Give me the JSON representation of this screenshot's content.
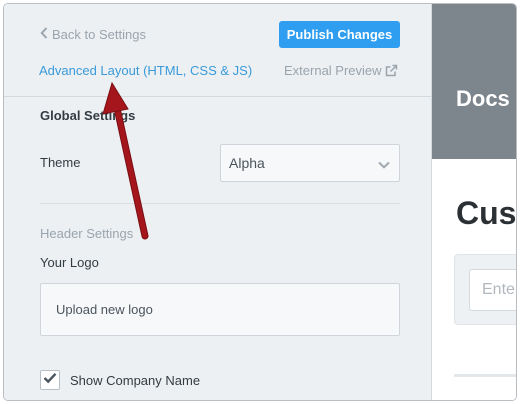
{
  "settings": {
    "back_label": "Back to Settings",
    "publish_label": "Publish Changes",
    "advanced_layout_label": "Advanced Layout (HTML, CSS & JS)",
    "external_preview_label": "External Preview",
    "global_settings_label": "Global Settings",
    "theme_label": "Theme",
    "theme_value": "Alpha",
    "header_settings_label": "Header Settings",
    "logo_label": "Your Logo",
    "upload_label": "Upload new logo",
    "show_company_label": "Show Company Name",
    "show_company_checked": true
  },
  "preview": {
    "brand": "Docs",
    "title": "Cust",
    "search_placeholder": "Ente"
  },
  "colors": {
    "accent": "#2f9ef0",
    "link": "#3a9ad9",
    "arrow": "#a4161c",
    "preview_header": "#7d858d"
  },
  "icons": {
    "back": "chevron-left-icon",
    "external": "external-link-icon",
    "select": "chevron-down-icon",
    "checkbox": "checkmark-icon"
  }
}
